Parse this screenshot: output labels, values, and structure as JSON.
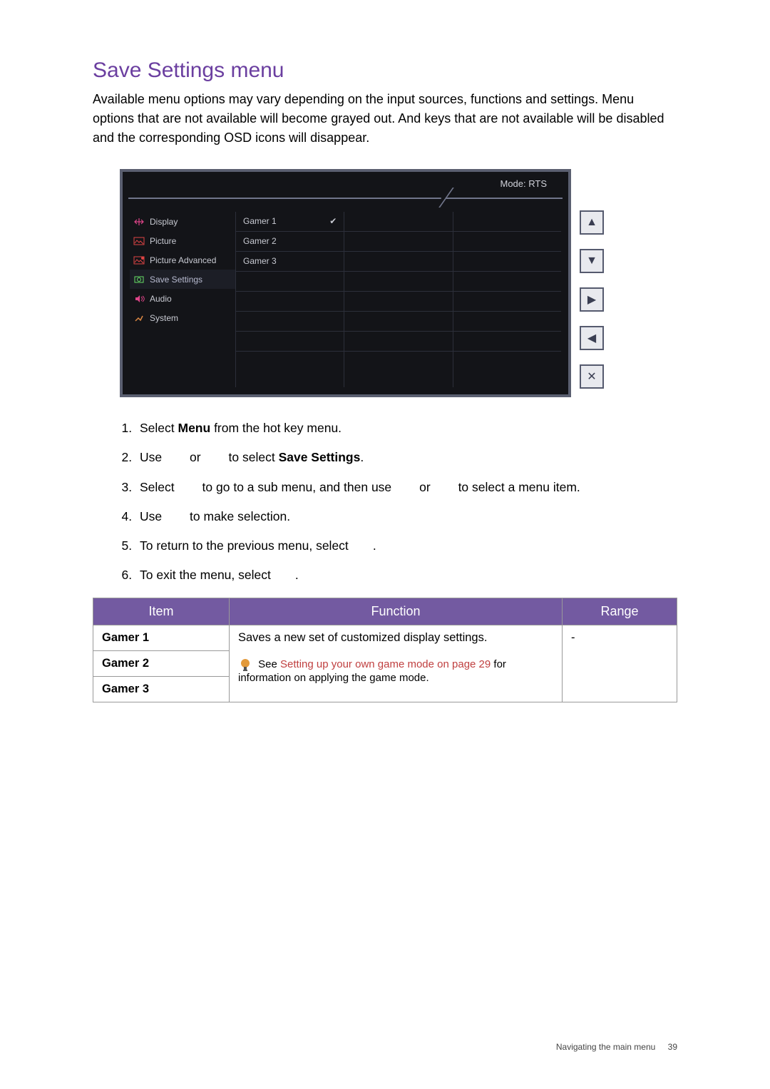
{
  "title": "Save Settings menu",
  "intro": "Available menu options may vary depending on the input sources, functions and settings. Menu options that are not available will become grayed out. And keys that are not available will be disabled and the corresponding OSD icons will disappear.",
  "osd": {
    "mode_label": "Mode: RTS",
    "sidebar": [
      {
        "label": "Display",
        "icon": "display"
      },
      {
        "label": "Picture",
        "icon": "picture"
      },
      {
        "label": "Picture Advanced",
        "icon": "picture-adv"
      },
      {
        "label": "Save Settings",
        "icon": "save",
        "active": true
      },
      {
        "label": "Audio",
        "icon": "audio"
      },
      {
        "label": "System",
        "icon": "system"
      }
    ],
    "options": [
      {
        "label": "Gamer 1",
        "checked": true
      },
      {
        "label": "Gamer 2",
        "checked": false
      },
      {
        "label": "Gamer 3",
        "checked": false
      }
    ]
  },
  "buttons": {
    "up_glyph": "▲",
    "down_glyph": "▼",
    "right_glyph": "▶",
    "left_glyph": "◀",
    "close_glyph": "✕"
  },
  "steps": {
    "s1_pre": "Select ",
    "s1_b": "Menu",
    "s1_post": " from the hot key menu.",
    "s2_pre": "Use ",
    "s2_or": " or ",
    "s2_mid": " to select ",
    "s2_b": "Save Settings",
    "s2_post": ".",
    "s3_pre": "Select ",
    "s3_mid": " to go to a sub menu, and then use ",
    "s3_or": " or ",
    "s3_post": " to select a menu item.",
    "s4_pre": "Use ",
    "s4_post": " to make selection.",
    "s5_pre": "To return to the previous menu, select ",
    "s5_post": ".",
    "s6_pre": "To exit the menu, select ",
    "s6_post": "."
  },
  "table": {
    "head_item": "Item",
    "head_function": "Function",
    "head_range": "Range",
    "r1_item": "Gamer 1",
    "r2_item": "Gamer 2",
    "r3_item": "Gamer 3",
    "func_main": "Saves a new set of customized display settings.",
    "func_note_pre": "See ",
    "func_note_link": "Setting up your own game mode on page 29",
    "func_note_post": " for information on applying the game mode.",
    "range": "-"
  },
  "footer": {
    "text": "Navigating the main menu",
    "page": "39"
  }
}
